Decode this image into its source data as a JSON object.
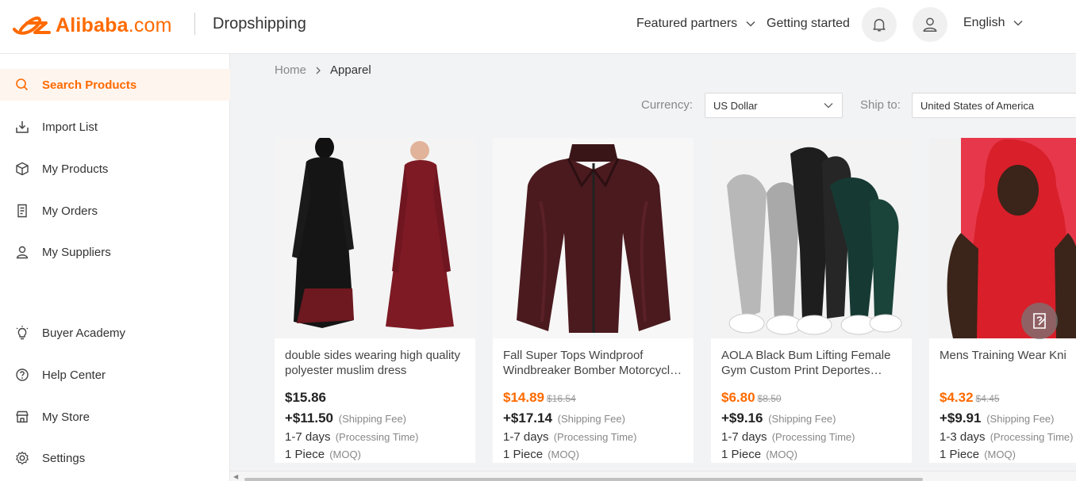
{
  "header": {
    "logo_text": "Alibaba",
    "logo_suffix": ".com",
    "product_title": "Dropshipping",
    "featured_partners": "Featured partners",
    "getting_started": "Getting started",
    "language": "English"
  },
  "sidebar": {
    "items": [
      {
        "label": "Search Products",
        "icon": "search-icon"
      },
      {
        "label": "Import List",
        "icon": "import-icon"
      },
      {
        "label": "My Products",
        "icon": "box-icon"
      },
      {
        "label": "My Orders",
        "icon": "orders-icon"
      },
      {
        "label": "My Suppliers",
        "icon": "user-icon"
      },
      {
        "label": "Buyer Academy",
        "icon": "lightbulb-icon"
      },
      {
        "label": "Help Center",
        "icon": "help-icon"
      },
      {
        "label": "My Store",
        "icon": "store-icon"
      },
      {
        "label": "Settings",
        "icon": "gear-icon"
      }
    ]
  },
  "breadcrumb": {
    "home": "Home",
    "current": "Apparel"
  },
  "filters": {
    "currency_label": "Currency:",
    "currency_value": "US Dollar",
    "ship_label": "Ship to:",
    "ship_value": "United States of America"
  },
  "products": [
    {
      "title": "double sides wearing high quality polyester muslim dress",
      "price": "$15.86",
      "original_price": "",
      "shipping": "+$11.50",
      "shipping_note": "(Shipping Fee)",
      "processing": "1-7 days",
      "processing_note": "(Processing Time)",
      "moq": "1 Piece",
      "moq_note": "(MOQ)"
    },
    {
      "title": "Fall Super Tops Windproof Windbreaker Bomber Motorcycle Jacket",
      "price": "$14.89",
      "original_price": "$16.54",
      "shipping": "+$17.14",
      "shipping_note": "(Shipping Fee)",
      "processing": "1-7 days",
      "processing_note": "(Processing Time)",
      "moq": "1 Piece",
      "moq_note": "(MOQ)"
    },
    {
      "title": "AOLA Black Bum Lifting Female Gym Custom Print Deportes Leggings",
      "price": "$6.80",
      "original_price": "$8.50",
      "shipping": "+$9.16",
      "shipping_note": "(Shipping Fee)",
      "processing": "1-7 days",
      "processing_note": "(Processing Time)",
      "moq": "1 Piece",
      "moq_note": "(MOQ)"
    },
    {
      "title": "Mens Training Wear Knitted Cotton Sports Hoodie Top",
      "price": "$4.32",
      "original_price": "$4.45",
      "shipping": "+$9.91",
      "shipping_note": "(Shipping Fee)",
      "processing": "1-3 days",
      "processing_note": "(Processing Time)",
      "moq": "1 Piece",
      "moq_note": "(MOQ)"
    }
  ],
  "colors": {
    "accent": "#ff6a00",
    "background": "#f2f3f5"
  }
}
